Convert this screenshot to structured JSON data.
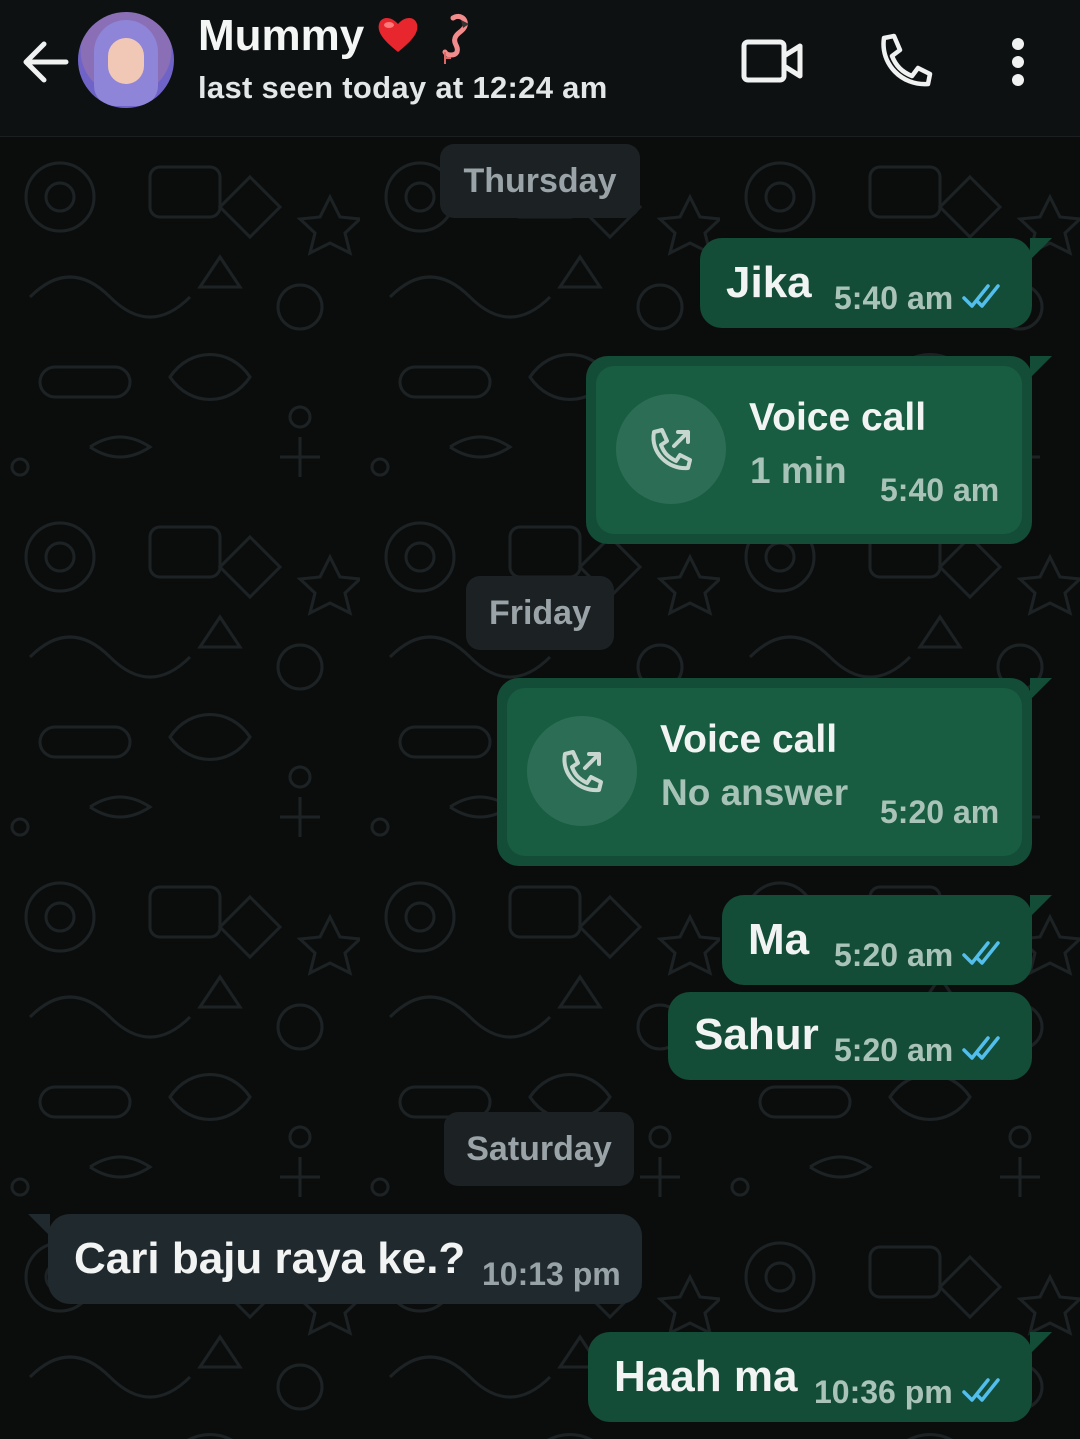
{
  "header": {
    "contact_name": "Mummy",
    "status": "last seen today at 12:24 am",
    "name_emojis": [
      "red-heart",
      "flamingo"
    ]
  },
  "colors": {
    "background": "#0b0d0d",
    "header": "#0e1112",
    "outgoing_bubble": "#144d37",
    "incoming_bubble": "#202a2e",
    "read_ticks": "#53bdeb"
  },
  "chat": {
    "day_thursday": "Thursday",
    "msg_jika": {
      "text": "Jika",
      "time": "5:40 am",
      "status": "read"
    },
    "call_1": {
      "title": "Voice call",
      "detail": "1 min",
      "time": "5:40 am"
    },
    "day_friday": "Friday",
    "call_2": {
      "title": "Voice call",
      "detail": "No answer",
      "time": "5:20 am"
    },
    "msg_ma": {
      "text": "Ma",
      "time": "5:20 am",
      "status": "read"
    },
    "msg_sahur": {
      "text": "Sahur",
      "time": "5:20 am",
      "status": "read"
    },
    "day_saturday": "Saturday",
    "msg_cari": {
      "text": "Cari baju raya ke.?",
      "time": "10:13 pm"
    },
    "msg_haah": {
      "text": "Haah ma",
      "time": "10:36 pm",
      "status": "read"
    }
  }
}
